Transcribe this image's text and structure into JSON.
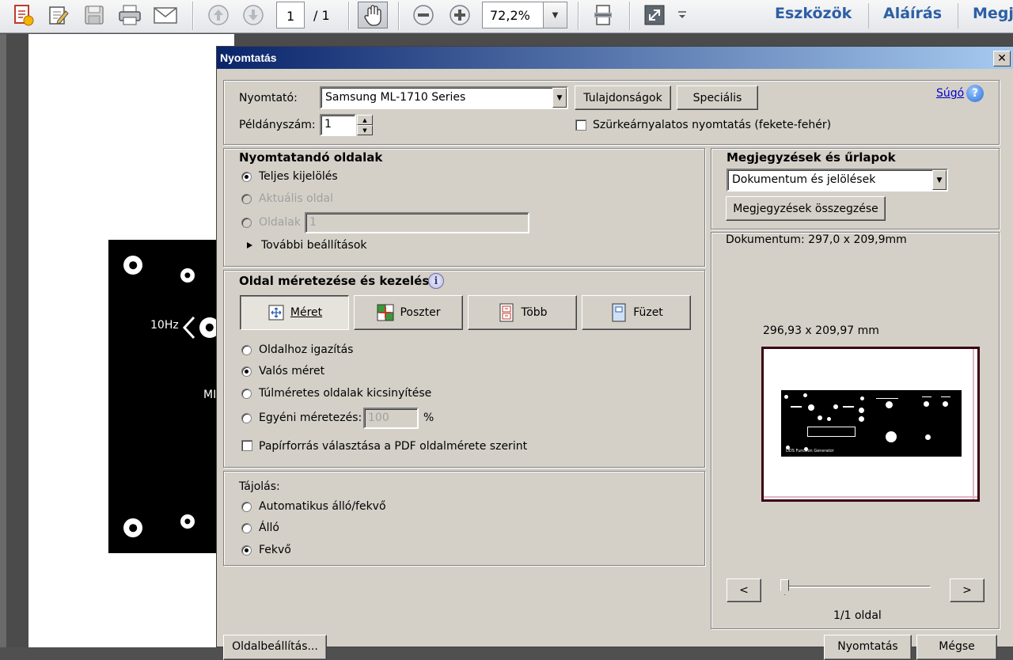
{
  "toolbar": {
    "page_current": "1",
    "page_total": "/ 1",
    "zoom": "72,2%",
    "links": [
      "Eszközök",
      "Aláírás",
      "Megj"
    ]
  },
  "document": {
    "panel_label_freq": "10Hz",
    "panel_label_partial": "MI"
  },
  "dialog": {
    "title": "Nyomtatás",
    "close_glyph": "✕",
    "help_link": "Súgó",
    "printer_label": "Nyomtató:",
    "printer_value": "Samsung ML-1710 Series",
    "properties_button": "Tulajdonságok",
    "advanced_button": "Speciális",
    "copies_label": "Példányszám:",
    "copies_value": "1",
    "grayscale_label": "Szürkeárnyalatos nyomtatás (fekete-fehér)",
    "pages_section": {
      "title": "Nyomtatandó oldalak",
      "opt_all": "Teljes kijelölés",
      "opt_current": "Aktuális oldal",
      "opt_pages": "Oldalak",
      "pages_value": "1",
      "more_options": "További beállítások"
    },
    "sizing_section": {
      "title": "Oldal méretezése és kezelése",
      "tab_size": "Méret",
      "tab_poster": "Poszter",
      "tab_multiple": "Több",
      "tab_booklet": "Füzet",
      "opt_fit": "Oldalhoz igazítás",
      "opt_actual": "Valós méret",
      "opt_shrink": "Túlméretes oldalak kicsinyítése",
      "opt_custom": "Egyéni méretezés:",
      "custom_value": "100",
      "percent": "%",
      "paper_source": "Papírforrás választása a PDF oldalmérete szerint"
    },
    "orientation_section": {
      "title": "Tájolás:",
      "opt_auto": "Automatikus álló/fekvő",
      "opt_portrait": "Álló",
      "opt_landscape": "Fekvő"
    },
    "comments_section": {
      "title": "Megjegyzések és űrlapok",
      "select_value": "Dokumentum és jelölések",
      "summarize_button": "Megjegyzések összegzése"
    },
    "preview": {
      "doc_size": "Dokumentum: 297,0 x 209,9mm",
      "paper_size": "296,93 x 209,97 mm",
      "prev": "<",
      "next": ">",
      "page_info": "1/1 oldal",
      "mini_caption": "DDS Function Generator",
      "slider_position": 0
    },
    "footer": {
      "page_setup": "Oldalbeállítás...",
      "print": "Nyomtatás",
      "cancel": "Mégse"
    }
  }
}
